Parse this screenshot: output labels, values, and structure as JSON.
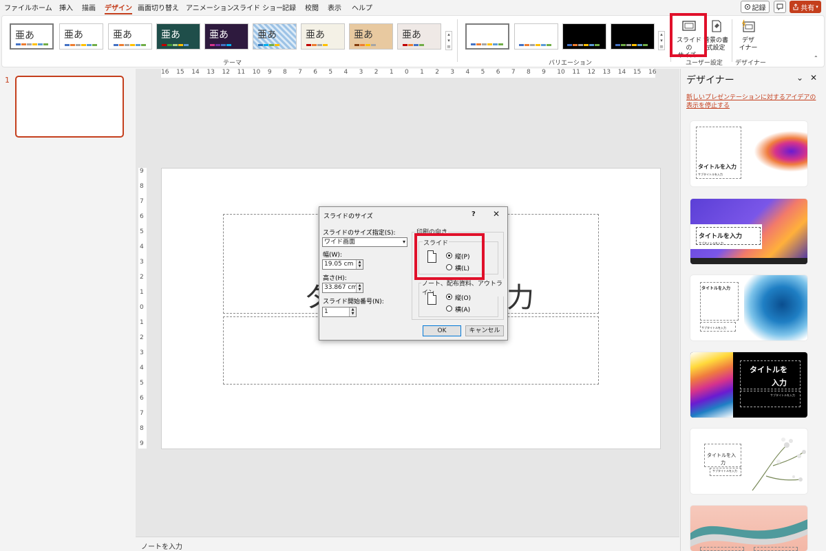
{
  "menu": {
    "items": [
      "ファイル",
      "ホーム",
      "挿入",
      "描画",
      "デザイン",
      "画面切り替え",
      "アニメーション",
      "スライド ショー",
      "記録",
      "校閲",
      "表示",
      "ヘルプ"
    ],
    "record_label": "記録",
    "share_label": "共有",
    "accent_color": "#c43e1c"
  },
  "ribbon": {
    "theme_sample_text": "亜あ",
    "group_theme_label": "テーマ",
    "group_variation_label": "バリエーション",
    "slide_size_label_1": "スライドの",
    "slide_size_label_2": "サイズ",
    "bg_format_label_1": "背景の書",
    "bg_format_label_2": "式設定",
    "group_user_label": "ユーザー設定",
    "designer_btn_label_1": "デザ",
    "designer_btn_label_2": "イナー",
    "group_designer_label": "デザイナー"
  },
  "thumbnails": {
    "slide_number": "1"
  },
  "ruler": {
    "horizontal": [
      "16",
      "15",
      "14",
      "13",
      "12",
      "11",
      "10",
      "9",
      "8",
      "7",
      "6",
      "5",
      "4",
      "3",
      "2",
      "1",
      "0",
      "1",
      "2",
      "3",
      "4",
      "5",
      "6",
      "7",
      "8",
      "9",
      "10",
      "11",
      "12",
      "13",
      "14",
      "15",
      "16"
    ],
    "vertical": [
      "9",
      "8",
      "7",
      "6",
      "5",
      "4",
      "3",
      "2",
      "1",
      "0",
      "1",
      "2",
      "3",
      "4",
      "5",
      "6",
      "7",
      "8",
      "9"
    ]
  },
  "slide": {
    "title_frag_left": "タ",
    "title_frag_right": "力"
  },
  "notes": {
    "placeholder": "ノートを入力"
  },
  "dialog": {
    "title": "スライドのサイズ",
    "help": "?",
    "close": "✕",
    "size_spec_label": "スライドのサイズ指定(S):",
    "size_spec_value": "ワイド画面",
    "width_label": "幅(W):",
    "width_value": "19.05 cm",
    "height_label": "高さ(H):",
    "height_value": "33.867 cm",
    "start_num_label": "スライド開始番号(N):",
    "start_num_value": "1",
    "orientation_label": "印刷の向き",
    "slide_group_label": "スライド",
    "slide_portrait": "縦(P)",
    "slide_landscape": "横(L)",
    "notes_group_label": "ノート、配布資料、アウトライン",
    "notes_portrait": "縦(O)",
    "notes_landscape": "横(A)",
    "ok": "OK",
    "cancel": "キャンセル"
  },
  "designer": {
    "title": "デザイナー",
    "link": "新しいプレゼンテーションに対するアイデアの表示を停止する",
    "card_title": "タイトルを入力",
    "card_title_split_1": "タイトルを",
    "card_title_split_2": "入力",
    "card_title_split_3": "タイトルを入",
    "card_title_split_4": "力",
    "card_sub": "サブタイトルを入力"
  }
}
